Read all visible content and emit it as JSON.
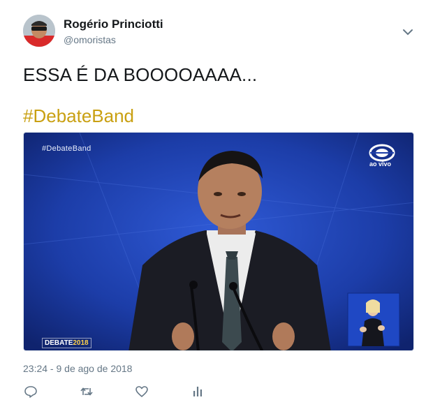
{
  "author": {
    "name": "Rogério Princiotti",
    "handle": "@omoristas"
  },
  "tweet": {
    "text": "ESSA É DA BOOOOAAAA...",
    "hashtag": "#DebateBand",
    "timestamp": "23:24 - 9 de ago de 2018"
  },
  "media": {
    "overlay_tag": "#DebateBand",
    "channel_live": "ao vivo",
    "badge_text": "DEBATE",
    "badge_year": "2018"
  },
  "actions": [
    "reply-icon",
    "retweet-icon",
    "like-icon",
    "analytics-icon"
  ],
  "colors": {
    "hashtag": "#c9a012",
    "secondary_text": "#657786",
    "stage_blue": "#1b3fb0"
  }
}
